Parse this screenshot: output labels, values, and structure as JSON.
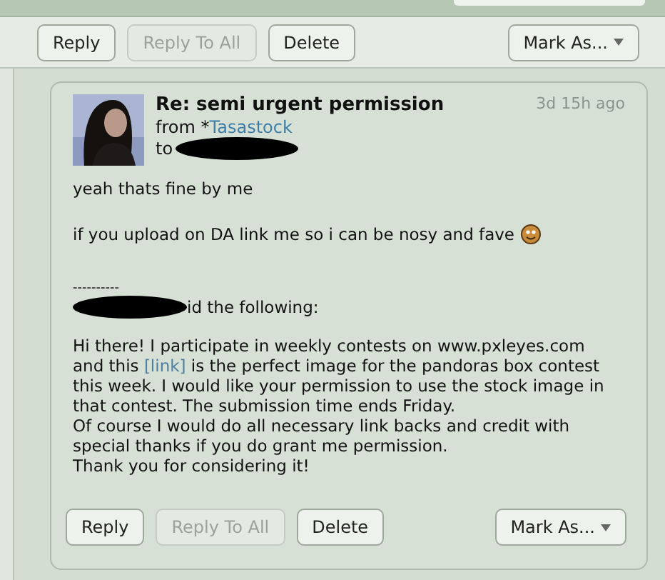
{
  "toolbar": {
    "buttons": [
      {
        "label": "Reply",
        "kind": "button",
        "disabled": false
      },
      {
        "label": "Reply To All",
        "kind": "button",
        "disabled": true
      },
      {
        "label": "Delete",
        "kind": "button",
        "disabled": false
      },
      {
        "label": "Mark As...",
        "kind": "dropdown",
        "disabled": false
      }
    ]
  },
  "message": {
    "avatar": {
      "kind": "picture"
    },
    "title": "Re: semi urgent permission",
    "from_label": "from",
    "sender_symbol": "*",
    "sender": "Tasastock",
    "to_label": "to",
    "time": "3d 15h ago",
    "body": [
      "yeah thats fine by me",
      "if you upload on DA link me so i can be nosy and fave"
    ],
    "separator": "----------",
    "quote_intro": "id the following:",
    "quote": [
      {
        "before": "Hi there! I participate in weekly contests on www.pxleyes.com and this ",
        "link": "[link]",
        "after": " is the perfect image for the pandoras box contest this week. I would like your permission to use the stock image in that contest. The submission time ends Friday."
      },
      {
        "before": "Of course I would do all necessary link backs and credit with special thanks if you do grant me permission."
      },
      {
        "before": "Thank you for considering it!"
      }
    ]
  },
  "bottom_toolbar": {
    "buttons": [
      {
        "label": "Reply",
        "kind": "button",
        "disabled": false
      },
      {
        "label": "Reply To All",
        "kind": "button",
        "disabled": true
      },
      {
        "label": "Delete",
        "kind": "button",
        "disabled": false
      },
      {
        "label": "Mark As...",
        "kind": "dropdown",
        "disabled": false
      }
    ]
  }
}
